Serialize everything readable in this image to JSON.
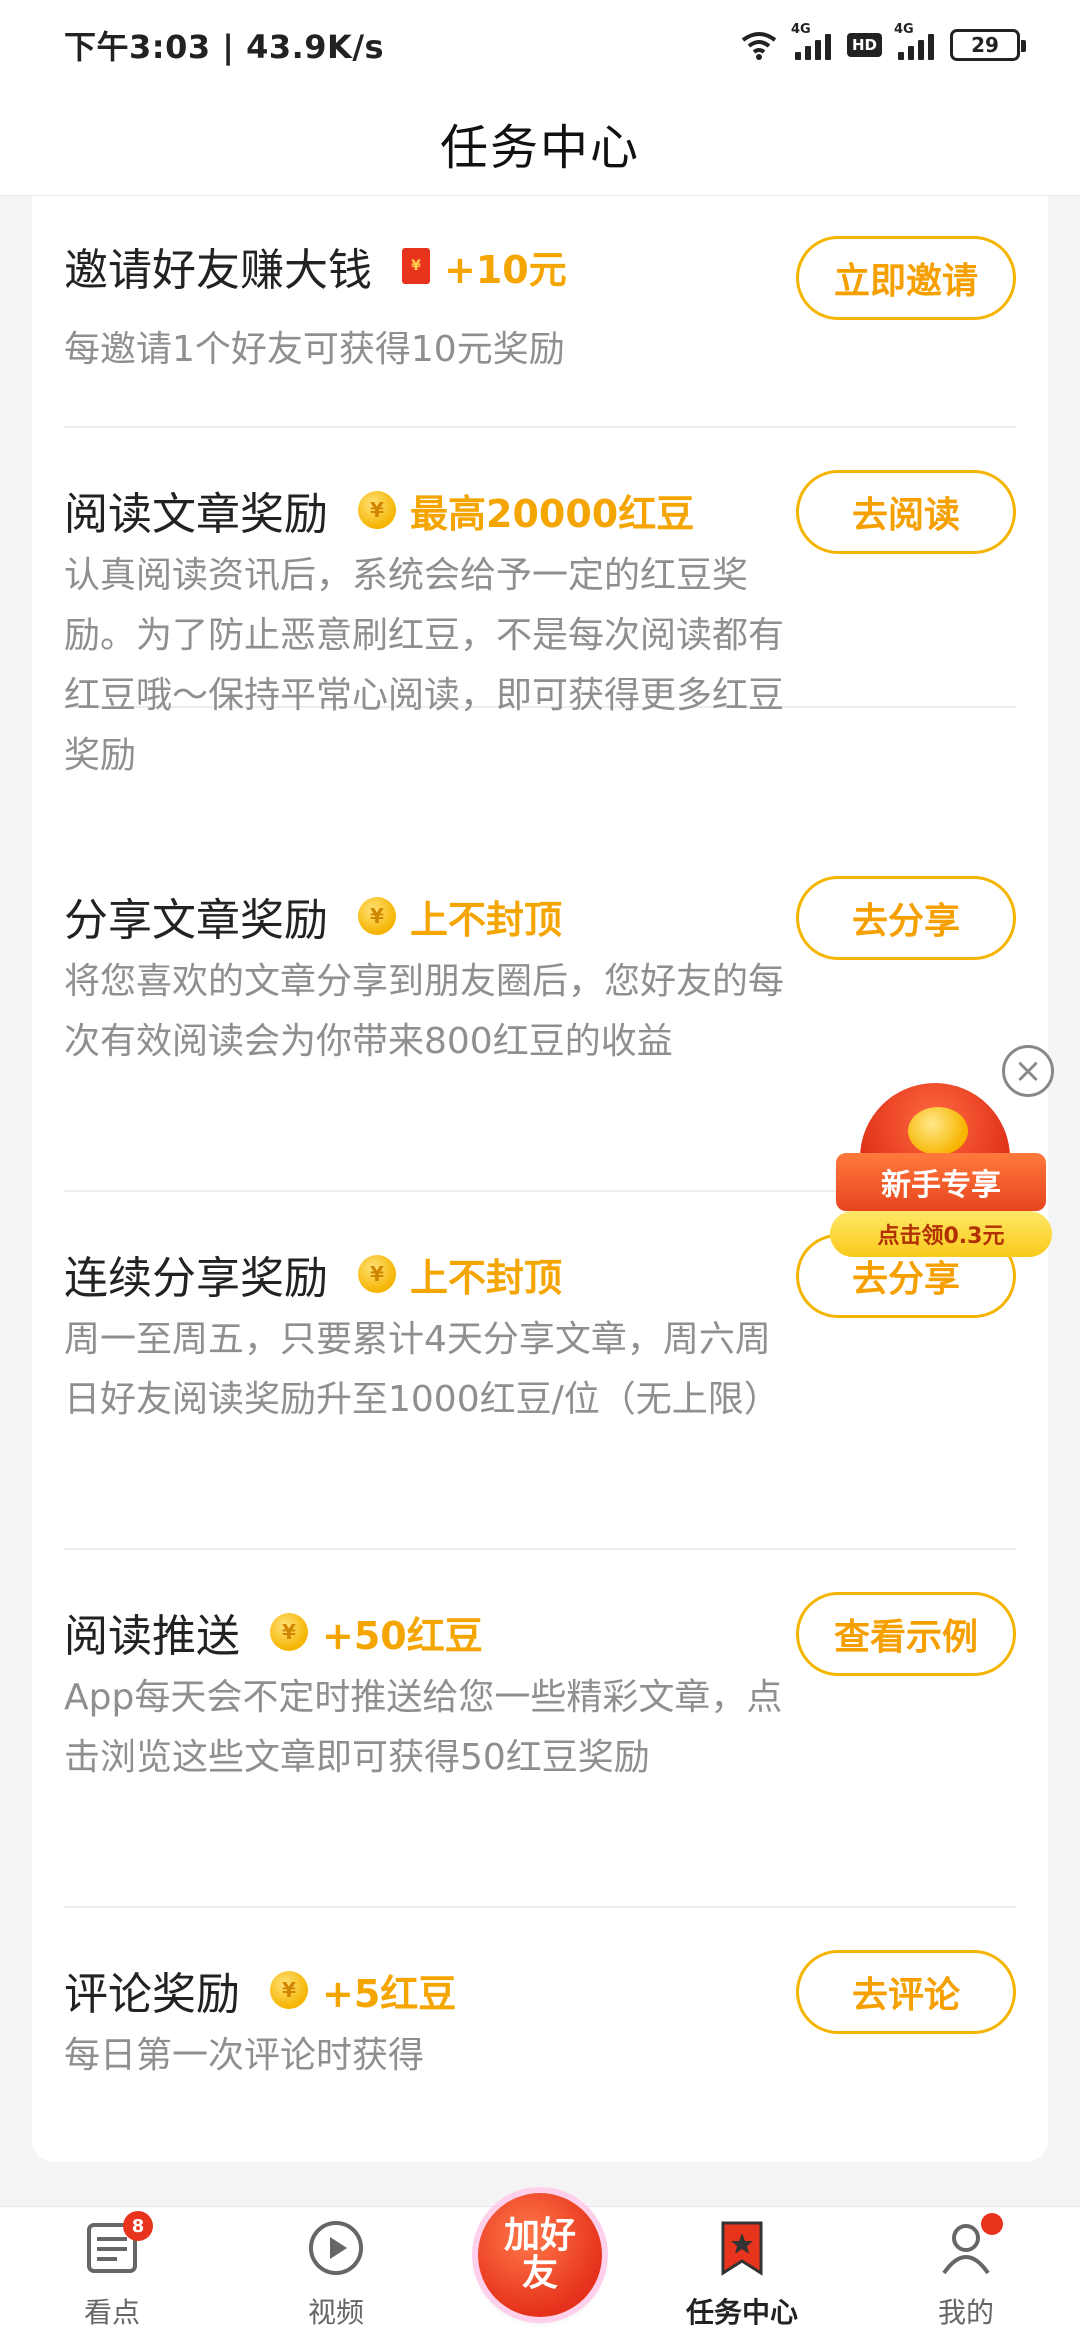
{
  "status_bar": {
    "time_speed": "下午3:03 | 43.9K/s",
    "network_1": "4G",
    "hd": "HD",
    "network_2": "4G",
    "battery": "29"
  },
  "header": {
    "title": "任务中心"
  },
  "tasks": [
    {
      "title": "邀请好友赚大钱",
      "reward_icon": "red-packet-icon",
      "reward": "+10元",
      "desc": "每邀请1个好友可获得10元奖励",
      "button": "立即邀请"
    },
    {
      "title": "阅读文章奖励",
      "reward_icon": "coin-icon",
      "reward": "最高20000红豆",
      "desc": "认真阅读资讯后，系统会给予一定的红豆奖励。为了防止恶意刷红豆，不是每次阅读都有红豆哦～保持平常心阅读，即可获得更多红豆奖励",
      "button": "去阅读"
    },
    {
      "title": "分享文章奖励",
      "reward_icon": "coin-icon",
      "reward": "上不封顶",
      "desc": "将您喜欢的文章分享到朋友圈后，您好友的每次有效阅读会为你带来800红豆的收益",
      "button": "去分享"
    },
    {
      "title": "连续分享奖励",
      "reward_icon": "coin-icon",
      "reward": "上不封顶",
      "desc": "周一至周五，只要累计4天分享文章，周六周日好友阅读奖励升至1000红豆/位（无上限）",
      "button": "去分享"
    },
    {
      "title": "阅读推送",
      "reward_icon": "coin-icon",
      "reward": "+50红豆",
      "desc": "App每天会不定时推送给您一些精彩文章，点击浏览这些文章即可获得50红豆奖励",
      "button": "查看示例"
    },
    {
      "title": "评论奖励",
      "reward_icon": "coin-icon",
      "reward": "+5红豆",
      "desc": "每日第一次评论时获得",
      "button": "去评论"
    }
  ],
  "promo": {
    "title": "新手专享",
    "subtitle": "点击领0.3元"
  },
  "bottom_nav": {
    "items": [
      {
        "label": "看点",
        "badge": "8"
      },
      {
        "label": "视频"
      },
      {
        "label": "加好友"
      },
      {
        "label": "任务中心"
      },
      {
        "label": "我的"
      }
    ]
  },
  "colors": {
    "accent": "#f5a500",
    "badge": "#e8341c"
  }
}
